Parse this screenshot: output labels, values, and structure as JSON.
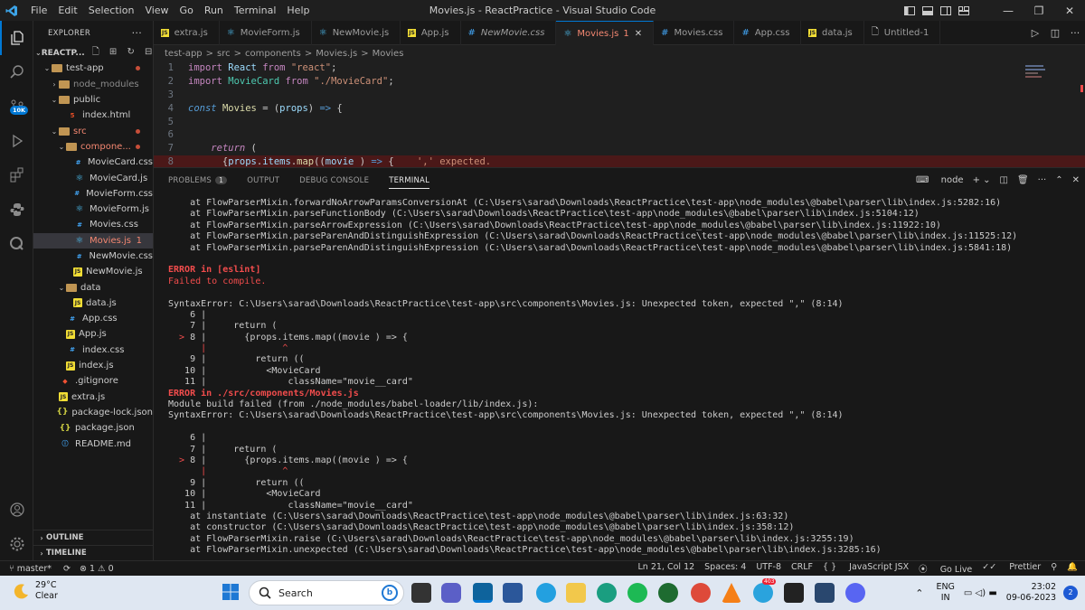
{
  "window": {
    "title": "Movies.js - ReactPractice - Visual Studio Code",
    "menu": [
      "File",
      "Edit",
      "Selection",
      "View",
      "Go",
      "Run",
      "Terminal",
      "Help"
    ]
  },
  "activity_badge": "10K",
  "explorer": {
    "header": "EXPLORER",
    "root": "REACTP...",
    "items": [
      {
        "label": "test-app",
        "depth": 1,
        "kind": "folder",
        "open": true,
        "dot": true
      },
      {
        "label": "node_modules",
        "depth": 2,
        "kind": "folder",
        "open": false,
        "dim": true
      },
      {
        "label": "public",
        "depth": 2,
        "kind": "folder",
        "open": true
      },
      {
        "label": "index.html",
        "depth": 3,
        "kind": "html"
      },
      {
        "label": "src",
        "depth": 2,
        "kind": "folder",
        "open": true,
        "dot": true,
        "red": true
      },
      {
        "label": "compone...",
        "depth": 3,
        "kind": "folder",
        "open": true,
        "dot": true,
        "red": true
      },
      {
        "label": "MovieCard.css",
        "depth": 4,
        "kind": "css"
      },
      {
        "label": "MovieCard.js",
        "depth": 4,
        "kind": "react"
      },
      {
        "label": "MovieForm.css",
        "depth": 4,
        "kind": "css"
      },
      {
        "label": "MovieForm.js",
        "depth": 4,
        "kind": "react"
      },
      {
        "label": "Movies.css",
        "depth": 4,
        "kind": "css"
      },
      {
        "label": "Movies.js",
        "depth": 4,
        "kind": "react",
        "selected": true,
        "count": "1",
        "red": true
      },
      {
        "label": "NewMovie.css",
        "depth": 4,
        "kind": "css"
      },
      {
        "label": "NewMovie.js",
        "depth": 4,
        "kind": "js"
      },
      {
        "label": "data",
        "depth": 3,
        "kind": "folder",
        "open": true
      },
      {
        "label": "data.js",
        "depth": 4,
        "kind": "js"
      },
      {
        "label": "App.css",
        "depth": 3,
        "kind": "css"
      },
      {
        "label": "App.js",
        "depth": 3,
        "kind": "js"
      },
      {
        "label": "index.css",
        "depth": 3,
        "kind": "css"
      },
      {
        "label": "index.js",
        "depth": 3,
        "kind": "js"
      },
      {
        "label": ".gitignore",
        "depth": 2,
        "kind": "git"
      },
      {
        "label": "extra.js",
        "depth": 2,
        "kind": "js"
      },
      {
        "label": "package-lock.json",
        "depth": 2,
        "kind": "json"
      },
      {
        "label": "package.json",
        "depth": 2,
        "kind": "json"
      },
      {
        "label": "README.md",
        "depth": 2,
        "kind": "info"
      }
    ],
    "outline": "OUTLINE",
    "timeline": "TIMELINE"
  },
  "tabs": [
    {
      "label": "extra.js",
      "icon": "js"
    },
    {
      "label": "MovieForm.js",
      "icon": "react"
    },
    {
      "label": "NewMovie.js",
      "icon": "react"
    },
    {
      "label": "App.js",
      "icon": "js"
    },
    {
      "label": "NewMovie.css",
      "icon": "css",
      "italic": true
    },
    {
      "label": "Movies.js",
      "icon": "react",
      "active": true,
      "count": "1"
    },
    {
      "label": "Movies.css",
      "icon": "css"
    },
    {
      "label": "App.css",
      "icon": "css"
    },
    {
      "label": "data.js",
      "icon": "js"
    },
    {
      "label": "Untitled-1",
      "icon": "file"
    }
  ],
  "breadcrumb": [
    "test-app",
    ">",
    "src",
    ">",
    "components",
    ">",
    "Movies.js",
    ">",
    "Movies"
  ],
  "editor_lines": [
    {
      "n": "1",
      "html": "<span class='kw2'>import</span> <span class='var'>React</span> <span class='kw2'>from</span> <span class='str'>\"react\"</span>;"
    },
    {
      "n": "2",
      "html": "<span class='kw2'>import</span> <span class='cls'>MovieCard</span> <span class='kw2'>from</span> <span class='str'>\"./MovieCard\"</span>;"
    },
    {
      "n": "3",
      "html": ""
    },
    {
      "n": "4",
      "html": "<span class='kw'><i>const</i></span> <span class='fn'>Movies</span> = (<span class='var'>props</span>) <span class='kw'>=&gt;</span> {"
    },
    {
      "n": "5",
      "html": ""
    },
    {
      "n": "6",
      "html": ""
    },
    {
      "n": "7",
      "html": "    <span class='kw2'><i>return</i></span> ("
    },
    {
      "n": "8",
      "html": "      {<span class='var'>props</span>.<span class='var'>items</span>.<span class='fn'>map</span>((<span class='var'>movie</span> ) <span class='kw'>=&gt;</span> {    <span class='str'>',' expected.</span>",
      "err": true
    }
  ],
  "panel": {
    "tabs": [
      "PROBLEMS",
      "OUTPUT",
      "DEBUG CONSOLE",
      "TERMINAL"
    ],
    "problems_count": "1",
    "shell": "node"
  },
  "terminal": [
    {
      "c": "",
      "t": "    at FlowParserMixin.forwardNoArrowParamsConversionAt (C:\\Users\\sarad\\Downloads\\ReactPractice\\test-app\\node_modules\\@babel\\parser\\lib\\index.js:5282:16)"
    },
    {
      "c": "",
      "t": "    at FlowParserMixin.parseFunctionBody (C:\\Users\\sarad\\Downloads\\ReactPractice\\test-app\\node_modules\\@babel\\parser\\lib\\index.js:5104:12)"
    },
    {
      "c": "",
      "t": "    at FlowParserMixin.parseArrowExpression (C:\\Users\\sarad\\Downloads\\ReactPractice\\test-app\\node_modules\\@babel\\parser\\lib\\index.js:11922:10)"
    },
    {
      "c": "",
      "t": "    at FlowParserMixin.parseParenAndDistinguishExpression (C:\\Users\\sarad\\Downloads\\ReactPractice\\test-app\\node_modules\\@babel\\parser\\lib\\index.js:11525:12)"
    },
    {
      "c": "",
      "t": "    at FlowParserMixin.parseParenAndDistinguishExpression (C:\\Users\\sarad\\Downloads\\ReactPractice\\test-app\\node_modules\\@babel\\parser\\lib\\index.js:5841:18)"
    },
    {
      "c": "",
      "t": ""
    },
    {
      "c": "err",
      "t": "ERROR in [eslint]"
    },
    {
      "c": "red",
      "t": "Failed to compile."
    },
    {
      "c": "",
      "t": ""
    },
    {
      "c": "",
      "t": "SyntaxError: C:\\Users\\sarad\\Downloads\\ReactPractice\\test-app\\src\\components\\Movies.js: Unexpected token, expected \",\" (8:14)"
    },
    {
      "c": "",
      "t": "    6 |"
    },
    {
      "c": "",
      "t": "    7 |     return ("
    },
    {
      "c": "mark",
      "t": "  > 8 |       {props.items.map((movie ) => {"
    },
    {
      "c": "caret",
      "t": "      |              ^"
    },
    {
      "c": "",
      "t": "    9 |         return (("
    },
    {
      "c": "",
      "t": "   10 |           <MovieCard"
    },
    {
      "c": "",
      "t": "   11 |               className=\"movie__card\""
    },
    {
      "c": "err",
      "t": "ERROR in ./src/components/Movies.js"
    },
    {
      "c": "",
      "t": "Module build failed (from ./node_modules/babel-loader/lib/index.js):"
    },
    {
      "c": "",
      "t": "SyntaxError: C:\\Users\\sarad\\Downloads\\ReactPractice\\test-app\\src\\components\\Movies.js: Unexpected token, expected \",\" (8:14)"
    },
    {
      "c": "",
      "t": ""
    },
    {
      "c": "",
      "t": "    6 |"
    },
    {
      "c": "",
      "t": "    7 |     return ("
    },
    {
      "c": "mark",
      "t": "  > 8 |       {props.items.map((movie ) => {"
    },
    {
      "c": "caret",
      "t": "      |              ^"
    },
    {
      "c": "",
      "t": "    9 |         return (("
    },
    {
      "c": "",
      "t": "   10 |           <MovieCard"
    },
    {
      "c": "",
      "t": "   11 |               className=\"movie__card\""
    },
    {
      "c": "",
      "t": "    at instantiate (C:\\Users\\sarad\\Downloads\\ReactPractice\\test-app\\node_modules\\@babel\\parser\\lib\\index.js:63:32)"
    },
    {
      "c": "",
      "t": "    at constructor (C:\\Users\\sarad\\Downloads\\ReactPractice\\test-app\\node_modules\\@babel\\parser\\lib\\index.js:358:12)"
    },
    {
      "c": "",
      "t": "    at FlowParserMixin.raise (C:\\Users\\sarad\\Downloads\\ReactPractice\\test-app\\node_modules\\@babel\\parser\\lib\\index.js:3255:19)"
    },
    {
      "c": "",
      "t": "    at FlowParserMixin.unexpected (C:\\Users\\sarad\\Downloads\\ReactPractice\\test-app\\node_modules\\@babel\\parser\\lib\\index.js:3285:16)"
    }
  ],
  "status": {
    "branch": "master*",
    "problems": "⊗ 1 ⚠ 0",
    "position": "Ln 21, Col 12",
    "spaces": "Spaces: 4",
    "encoding": "UTF-8",
    "eol": "CRLF",
    "language": "JavaScript JSX",
    "golive": "Go Live",
    "prettier": "Prettier"
  },
  "taskbar": {
    "temp": "29°C",
    "condition": "Clear",
    "search_placeholder": "Search",
    "lang1": "ENG",
    "lang2": "IN",
    "time": "23:02",
    "date": "09-06-2023",
    "notif": "2",
    "telegram_badge": "403"
  },
  "colors": {
    "accent": "#0078d4",
    "error": "#f14c4c",
    "folder": "#c09553"
  }
}
